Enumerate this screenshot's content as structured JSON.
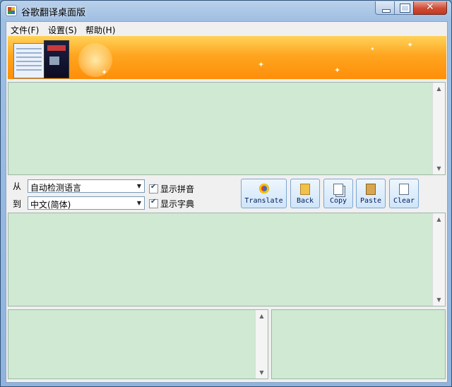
{
  "window": {
    "title": "谷歌翻译桌面版"
  },
  "menu": [
    "文件(F)",
    "设置(S)",
    "帮助(H)"
  ],
  "language": {
    "from_label": "从",
    "to_label": "到",
    "from_value": "自动检测语言",
    "to_value": "中文(简体)"
  },
  "options": {
    "show_pinyin": "显示拼音",
    "show_dictionary": "显示字典"
  },
  "toolbar": {
    "translate": "Translate",
    "back": "Back",
    "copy": "Copy",
    "paste": "Paste",
    "clear": "Clear"
  },
  "icons": {
    "translate": "translate-icon",
    "back": "back-folder-icon",
    "copy": "copy-icon",
    "paste": "paste-icon",
    "clear": "clear-page-icon"
  },
  "colors": {
    "pane_background": "#cfe9d2",
    "banner": "#ffa51f"
  }
}
